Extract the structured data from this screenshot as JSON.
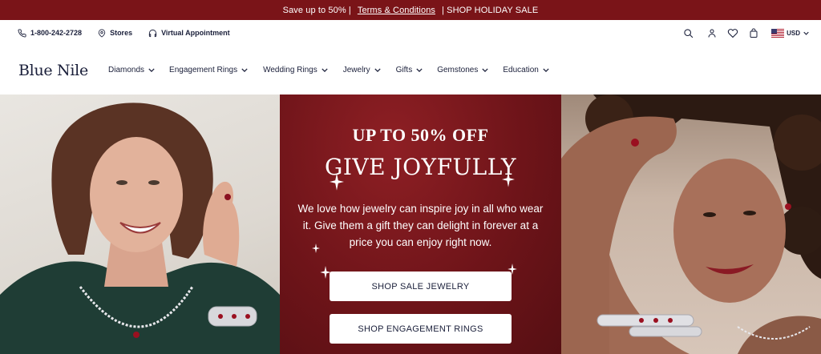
{
  "promo": {
    "prefix": "Save up to 50% |",
    "link": "Terms & Conditions",
    "suffix": "| SHOP HOLIDAY SALE"
  },
  "utility": {
    "phone": "1-800-242-2728",
    "stores": "Stores",
    "appointment": "Virtual Appointment",
    "currency": "USD"
  },
  "brand": {
    "logo": "Blue Nile"
  },
  "nav": {
    "items": [
      {
        "label": "Diamonds"
      },
      {
        "label": "Engagement Rings"
      },
      {
        "label": "Wedding Rings"
      },
      {
        "label": "Jewelry"
      },
      {
        "label": "Gifts"
      },
      {
        "label": "Gemstones"
      },
      {
        "label": "Education"
      }
    ]
  },
  "hero": {
    "subtitle": "UP TO 50% OFF",
    "title": "GIVE JOYFULLY",
    "body": "We love how jewelry can inspire joy in all who wear it. Give them a gift they can delight in forever at a price you can enjoy right now.",
    "button_primary": "SHOP SALE JEWELRY",
    "button_secondary": "SHOP ENGAGEMENT RINGS"
  },
  "colors": {
    "promo_bg": "#7a1418",
    "hero_bg": "#6e1419",
    "brand_text": "#1a1f3a"
  },
  "icons": [
    "phone-icon",
    "location-pin-icon",
    "headset-icon",
    "search-icon",
    "user-icon",
    "heart-icon",
    "bag-icon",
    "us-flag-icon",
    "chevron-down-icon",
    "sparkle-icon"
  ]
}
